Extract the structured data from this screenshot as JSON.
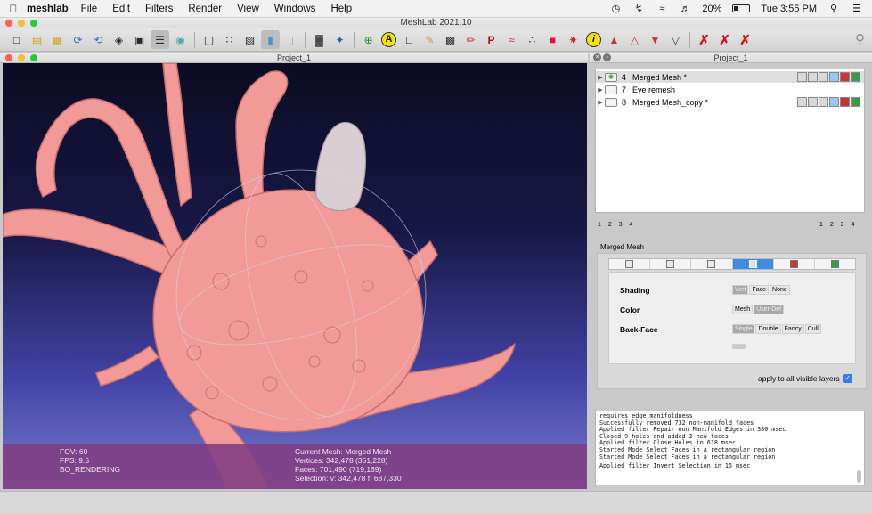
{
  "menubar": {
    "app_name": "meshlab",
    "items": [
      "File",
      "Edit",
      "Filters",
      "Render",
      "View",
      "Windows",
      "Help"
    ],
    "battery": "20%",
    "clock": "Tue 3:55 PM"
  },
  "window": {
    "title": "MeshLab 2021.10"
  },
  "viewport": {
    "title": "Project_1"
  },
  "panel": {
    "title": "Project_1"
  },
  "info": {
    "fov": "FOV: 60",
    "fps": "FPS:     9.5",
    "rendering": "BO_RENDERING",
    "current_mesh": "Current Mesh: Merged Mesh",
    "vertices": "Vertices: 342,478     (351,228)",
    "faces": "Faces: 701,490     (719,169)",
    "selection": "Selection: v: 342,478 f: 687,330"
  },
  "layers": [
    {
      "id": "4",
      "name": "Merged Mesh *",
      "selected": true
    },
    {
      "id": "7",
      "name": "Eye remesh",
      "selected": false
    },
    {
      "id": "8",
      "name": "Merged Mesh_copy *",
      "selected": false
    }
  ],
  "pager": {
    "left": "1 2 3 4",
    "right": "1 2 3 4"
  },
  "decorator": {
    "title": "Merged Mesh",
    "shading_label": "Shading",
    "shading_options": [
      "Vert",
      "Face",
      "None"
    ],
    "color_label": "Color",
    "color_options": [
      "Mesh",
      "User-Def"
    ],
    "backface_label": "Back-Face",
    "backface_options": [
      "Single",
      "Double",
      "Fancy",
      "Cull"
    ],
    "apply_label": "apply to all visible layers"
  },
  "log": [
    "requires edge manifoldness",
    "Successfully removed 732 non-manifold faces",
    "Applied filter Repair non Manifold Edges in 380 msec",
    "Closed 9 holes and added 2 new faces",
    "Applied filter Close Holes in 618 msec",
    "Started Mode Select Faces in a rectangular region",
    "Started Mode Select Faces in a rectangular region",
    "Applied filter Invert Selection in 15 msec"
  ],
  "colors": {
    "mesh": "#f29a98",
    "eye": "#d9cfd3",
    "info_bar": "#803c82",
    "accent": "#3e8de0"
  },
  "icons": [
    "apple-icon",
    "bluetooth-icon",
    "wifi-icon",
    "volume-icon",
    "battery-icon",
    "search-icon",
    "new-project-icon",
    "open-project-icon",
    "open-icon",
    "reload-icon",
    "reload-all-icon",
    "save-icon",
    "snapshot-icon",
    "layers-icon",
    "wireframe-icon",
    "bbox-icon",
    "points-icon",
    "lines-icon",
    "flat-icon",
    "smooth-icon",
    "texture-icon",
    "axis-icon",
    "trackball-icon",
    "annotate-icon",
    "measure-icon",
    "pick-icon",
    "paint-icon",
    "point-picker-icon",
    "align-icon",
    "georef-icon",
    "info-icon",
    "select-faces-icon",
    "select-vertices-icon",
    "delete-selection-icon"
  ]
}
